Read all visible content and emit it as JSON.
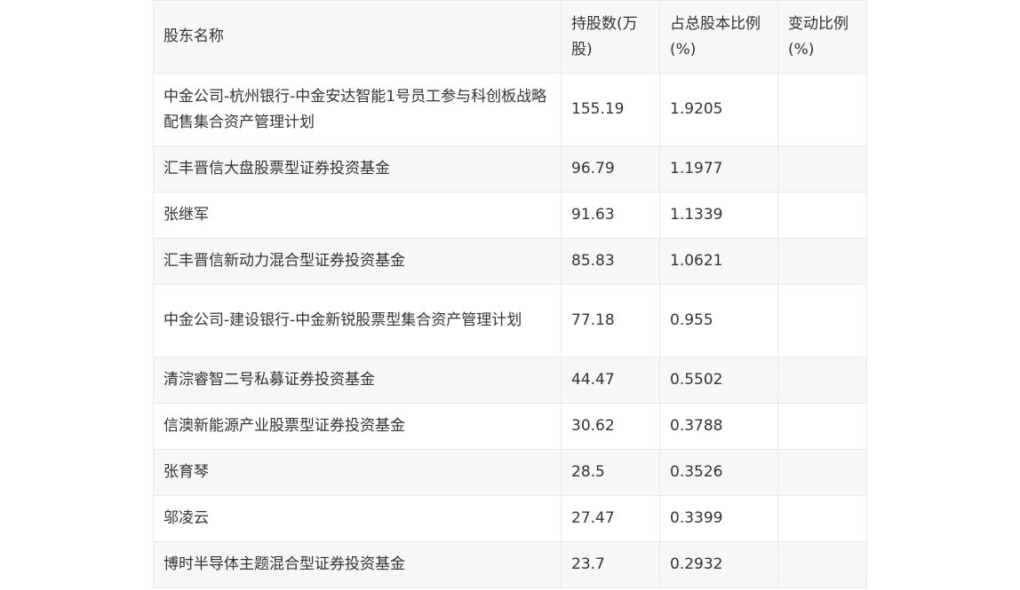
{
  "table": {
    "headers": [
      "股东名称",
      "持股数(万股)",
      "占总股本比例(%)",
      "变动比例(%)"
    ],
    "rows": [
      {
        "name": "中金公司-杭州银行-中金安达智能1号员工参与科创板战略配售集合资产管理计划",
        "shares": "155.19",
        "ratio": "1.9205",
        "change": ""
      },
      {
        "name": "汇丰晋信大盘股票型证券投资基金",
        "shares": "96.79",
        "ratio": "1.1977",
        "change": ""
      },
      {
        "name": "张继军",
        "shares": "91.63",
        "ratio": "1.1339",
        "change": ""
      },
      {
        "name": "汇丰晋信新动力混合型证券投资基金",
        "shares": "85.83",
        "ratio": "1.0621",
        "change": ""
      },
      {
        "name": "中金公司-建设银行-中金新锐股票型集合资产管理计划",
        "shares": "77.18",
        "ratio": "0.955",
        "change": ""
      },
      {
        "name": "清淙睿智二号私募证券投资基金",
        "shares": "44.47",
        "ratio": "0.5502",
        "change": ""
      },
      {
        "name": "信澳新能源产业股票型证券投资基金",
        "shares": "30.62",
        "ratio": "0.3788",
        "change": ""
      },
      {
        "name": "张育琴",
        "shares": "28.5",
        "ratio": "0.3526",
        "change": ""
      },
      {
        "name": "邬凌云",
        "shares": "27.47",
        "ratio": "0.3399",
        "change": ""
      },
      {
        "name": "博时半导体主题混合型证券投资基金",
        "shares": "23.7",
        "ratio": "0.2932",
        "change": ""
      }
    ]
  }
}
